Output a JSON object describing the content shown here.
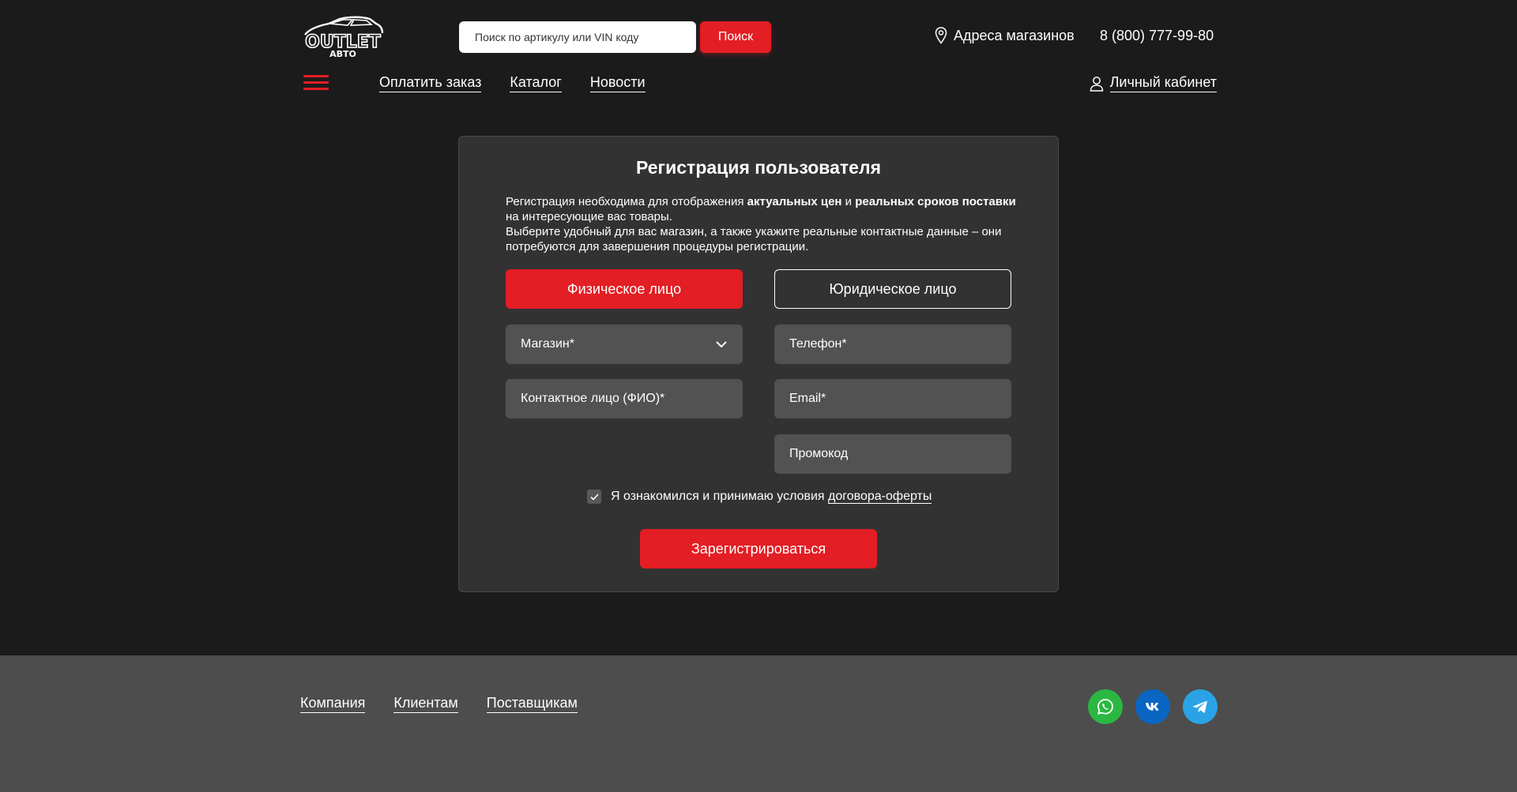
{
  "header": {
    "logo_text": "OUTLET",
    "logo_subtext": "АВТО",
    "search_placeholder": "Поиск по артикулу или VIN коду",
    "search_button": "Поиск",
    "stores_label": "Адреса магазинов",
    "phone": "8 (800) 777-99-80",
    "nav": [
      {
        "label": "Оплатить заказ"
      },
      {
        "label": "Каталог"
      },
      {
        "label": "Новости"
      }
    ],
    "cabinet_label": "Личный кабинет"
  },
  "registration": {
    "title": "Регистрация пользователя",
    "desc": {
      "p1_a": "Регистрация необходима для отображения ",
      "p1_b": "актуальных цен",
      "p1_c": " и ",
      "p1_d": "реальных сроков поставки",
      "p1_e": " на интересующие вас товары.",
      "p2": "Выберите удобный для вас магазин, а также укажите реальные контактные данные – они потребуются для завершения процедуры регистрации."
    },
    "type_individual": "Физическое лицо",
    "type_legal": "Юридическое лицо",
    "fields": {
      "store": "Магазин*",
      "phone": "Телефон*",
      "contact": "Контактное лицо (ФИО)*",
      "email": "Email*",
      "promo": "Промокод"
    },
    "agree_text": "Я ознакомился и принимаю условия",
    "agree_link": "договора-оферты",
    "agree_checked": true,
    "submit": "Зарегистрироваться"
  },
  "footer": {
    "nav": [
      {
        "label": "Компания"
      },
      {
        "label": "Клиентам"
      },
      {
        "label": "Поставщикам"
      }
    ],
    "socials": [
      {
        "name": "whatsapp-icon",
        "color": "#2cb742"
      },
      {
        "name": "vk-icon",
        "color": "#0a66c2"
      },
      {
        "name": "telegram-icon",
        "color": "#2aa3e6"
      }
    ]
  },
  "colors": {
    "accent": "#e31e24",
    "background": "#1c1b1c",
    "card": "#333233",
    "field": "#535253",
    "footer": "#4d4d4d"
  }
}
